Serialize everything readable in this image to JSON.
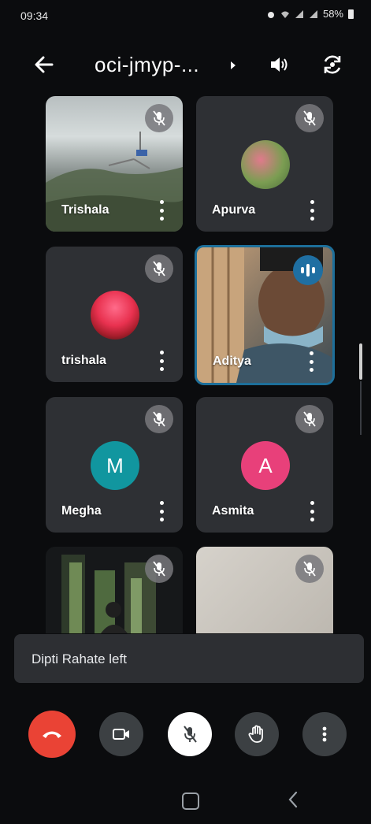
{
  "status_bar": {
    "time": "09:34",
    "battery": "58%"
  },
  "header": {
    "meeting_title": "oci-jmyp-...",
    "icons": [
      "back-arrow-icon",
      "caret-right-icon",
      "speaker-icon",
      "switch-camera-icon"
    ]
  },
  "participants": [
    {
      "name": "Trishala",
      "type": "video",
      "muted": true
    },
    {
      "name": "Apurva",
      "type": "avatar-photo",
      "muted": true
    },
    {
      "name": "trishala",
      "type": "avatar-photo",
      "muted": true
    },
    {
      "name": "Aditya",
      "type": "video",
      "muted": false,
      "speaking": true
    },
    {
      "name": "Megha",
      "type": "avatar-letter",
      "initial": "M",
      "color": "#11969f",
      "muted": true
    },
    {
      "name": "Asmita",
      "type": "avatar-letter",
      "initial": "A",
      "color": "#e8407a",
      "muted": true
    },
    {
      "name": "",
      "type": "video",
      "muted": true
    },
    {
      "name": "",
      "type": "video",
      "muted": true
    }
  ],
  "toast": {
    "message": "Dipti Rahate left"
  },
  "controls": [
    "end-call-button",
    "video-toggle-button",
    "mic-toggle-button",
    "raise-hand-button",
    "more-options-button"
  ],
  "colors": {
    "end_call": "#ea4335",
    "speaking_ring": "#1d6f9a",
    "tile_bg": "#2e3034"
  }
}
